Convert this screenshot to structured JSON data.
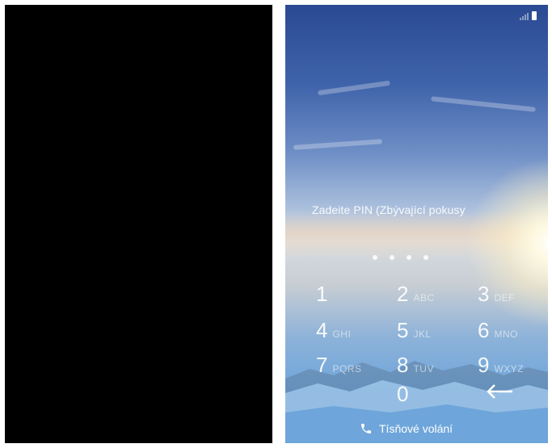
{
  "left_screen": {
    "state": "off"
  },
  "lock_screen": {
    "pin_prompt": "Zadeite PIN (Zbývající pokusy",
    "pin_entered_count": 4,
    "keys": [
      {
        "digit": "1",
        "letters": ""
      },
      {
        "digit": "2",
        "letters": "ABC"
      },
      {
        "digit": "3",
        "letters": "DEF"
      },
      {
        "digit": "4",
        "letters": "GHI"
      },
      {
        "digit": "5",
        "letters": "JKL"
      },
      {
        "digit": "6",
        "letters": "MNO"
      },
      {
        "digit": "7",
        "letters": "PQRS"
      },
      {
        "digit": "8",
        "letters": "TUV"
      },
      {
        "digit": "9",
        "letters": "WXYZ"
      },
      {
        "digit": "0",
        "letters": ""
      }
    ],
    "backspace_icon": "backspace-arrow-icon",
    "emergency_icon": "phone-icon",
    "emergency_label": "Tísňové volání",
    "status_icons": [
      "signal-icon",
      "battery-icon"
    ]
  },
  "colors": {
    "sky_top": "#2a4a93",
    "horizon": "#d9dde2",
    "mountain_blue": "#6ea5da",
    "text": "#ffffff"
  }
}
